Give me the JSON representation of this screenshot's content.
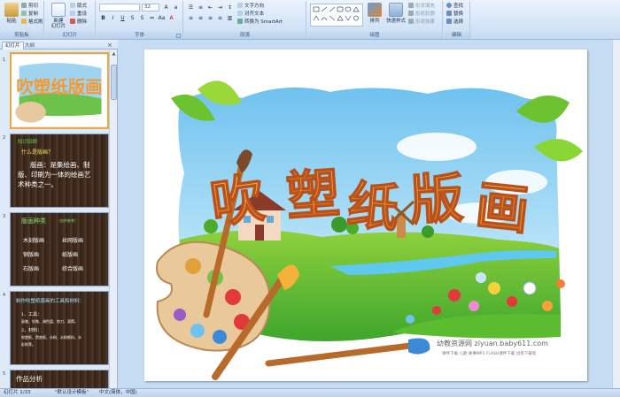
{
  "ribbon": {
    "clipboard": {
      "label": "剪贴板",
      "paste": "粘贴",
      "cut": "剪切",
      "copy": "复制",
      "format_painter": "格式刷"
    },
    "slides": {
      "label": "幻灯片",
      "new_slide": "新建",
      "new_slide_2": "幻灯片",
      "layout": "版式",
      "reset": "重设",
      "delete": "删除"
    },
    "font": {
      "label": "字体",
      "size_value": "32"
    },
    "paragraph": {
      "label": "段落",
      "text_direction": "文字方向",
      "align_text": "对齐文本",
      "smartart": "转换为 SmartArt"
    },
    "drawing": {
      "label": "绘图",
      "arrange": "排列",
      "quick_styles": "快速样式",
      "shape_fill": "形状填充",
      "shape_outline": "形状轮廓",
      "shape_effects": "形状效果"
    },
    "editing": {
      "label": "编辑",
      "find": "查找",
      "replace": "替换",
      "select": "选择"
    }
  },
  "panel": {
    "tab_slides": "幻灯片",
    "tab_outline": "大纲",
    "close": "×",
    "slides": [
      {
        "number": "1"
      },
      {
        "number": "2",
        "title": "知识回顾",
        "q": "什么是版画？",
        "body1": "版画：是集绘画、制",
        "body2": "版、印刷为一体的绘画艺",
        "body3": "术种类之一。"
      },
      {
        "number": "3",
        "title": "版画种类",
        "tag": "（仅供参考）",
        "c1": "木刻版画",
        "c2": "丝网版画",
        "c3": "铜版画",
        "c4": "纸版画",
        "c5": "石版画",
        "c6": "综合版画"
      },
      {
        "number": "4",
        "title": "制作吹塑纸版画的工具和材料：",
        "l1": "1、工具：",
        "l2": "画笔、铅笔、调色盘、剪刀、滚筒。",
        "l3": "2、材料：",
        "l4": "吹塑纸、黑底纸、水粉、水粉颜料、水",
        "l5": "彩纸等。"
      },
      {
        "number": "5",
        "title": "作品分析"
      }
    ]
  },
  "slide": {
    "title_chars": [
      "吹",
      "塑",
      "纸",
      "版",
      "画"
    ],
    "watermark_line1": "幼教资源网 ziyuan.baby611.com",
    "watermark_line2": "课件下载  儿歌  故事MP3  FLASH课件下载  试卷下载等"
  },
  "status": {
    "slide_count": "幻灯片 1/33",
    "theme": "\"默认设计模板\"",
    "language": "中文(简体，中国)"
  },
  "colors": {
    "title_gradient_top": "#f7b347",
    "title_gradient_bottom": "#e8731c",
    "selection": "#f2a73a"
  }
}
